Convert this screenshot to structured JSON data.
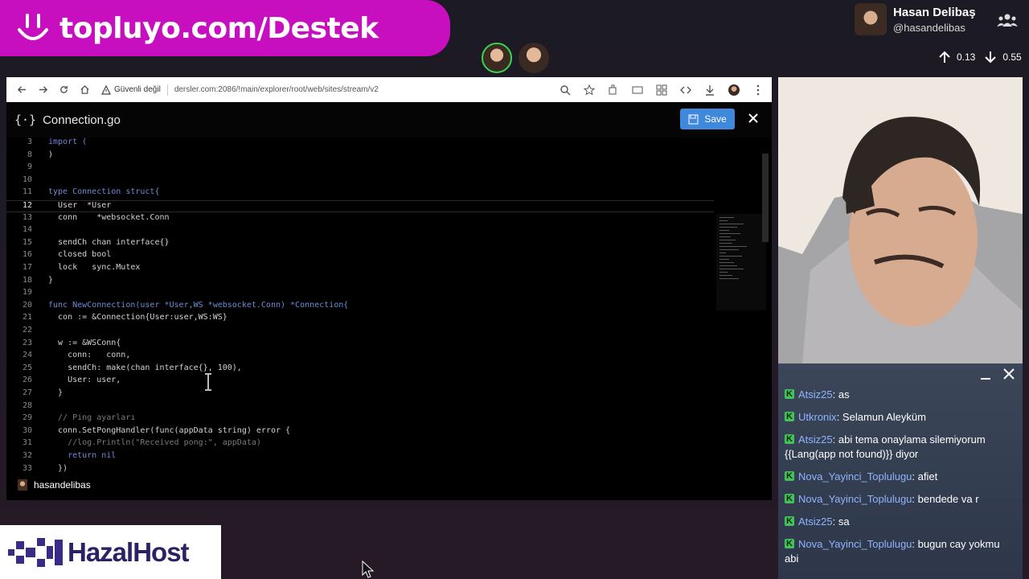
{
  "banner": {
    "text": "topluyo.com/Destek",
    "icon": "smiley-icon"
  },
  "streamer": {
    "name": "Hasan Delibaş",
    "handle": "@hasandelibas"
  },
  "stats": {
    "upload": "0.13",
    "download": "0.55"
  },
  "browser": {
    "insecure_label": "Güvenli değil",
    "url": "dersler.com:2086/!main/explorer/root/web/sites/stream/v2"
  },
  "editor": {
    "file_name": "Connection.go",
    "save_label": "Save",
    "active_line": "12",
    "lines": [
      {
        "n": "3",
        "t": "import ("
      },
      {
        "n": "8",
        "t": ")"
      },
      {
        "n": "9",
        "t": ""
      },
      {
        "n": "10",
        "t": ""
      },
      {
        "n": "11",
        "t": "type Connection struct{"
      },
      {
        "n": "12",
        "t": "  User  *User"
      },
      {
        "n": "13",
        "t": "  conn    *websocket.Conn"
      },
      {
        "n": "14",
        "t": ""
      },
      {
        "n": "15",
        "t": "  sendCh chan interface{}"
      },
      {
        "n": "16",
        "t": "  closed bool"
      },
      {
        "n": "17",
        "t": "  lock   sync.Mutex"
      },
      {
        "n": "18",
        "t": "}"
      },
      {
        "n": "19",
        "t": ""
      },
      {
        "n": "20",
        "t": "func NewConnection(user *User,WS *websocket.Conn) *Connection{"
      },
      {
        "n": "21",
        "t": "  con := &Connection{User:user,WS:WS}"
      },
      {
        "n": "22",
        "t": ""
      },
      {
        "n": "23",
        "t": "  w := &WSConn{"
      },
      {
        "n": "24",
        "t": "    conn:   conn,"
      },
      {
        "n": "25",
        "t": "    sendCh: make(chan interface{}, 100),"
      },
      {
        "n": "26",
        "t": "    User: user,"
      },
      {
        "n": "27",
        "t": "  }"
      },
      {
        "n": "28",
        "t": ""
      },
      {
        "n": "29",
        "t": "  // Ping ayarları"
      },
      {
        "n": "30",
        "t": "  conn.SetPongHandler(func(appData string) error {"
      },
      {
        "n": "31",
        "t": "    //log.Println(\"Received pong:\", appData)"
      },
      {
        "n": "32",
        "t": "    return nil"
      },
      {
        "n": "33",
        "t": "  })"
      }
    ],
    "presenter": "hasandelibas"
  },
  "chat": {
    "messages": [
      {
        "user": "Atsiz25",
        "text": "as"
      },
      {
        "user": "Utkronix",
        "text": "Selamun Aleyküm"
      },
      {
        "user": "Atsiz25",
        "text": "abi tema onaylama silemiyorum {{Lang(app not found)}} diyor"
      },
      {
        "user": "Nova_Yayinci_Toplulugu",
        "text": "afiet"
      },
      {
        "user": "Nova_Yayinci_Toplulugu",
        "text": "bendede va r"
      },
      {
        "user": "Atsiz25",
        "text": "sa"
      },
      {
        "user": "Nova_Yayinci_Toplulugu",
        "text": "bugun cay yokmu abi"
      }
    ]
  },
  "sponsor": {
    "name": "HazalHost"
  }
}
